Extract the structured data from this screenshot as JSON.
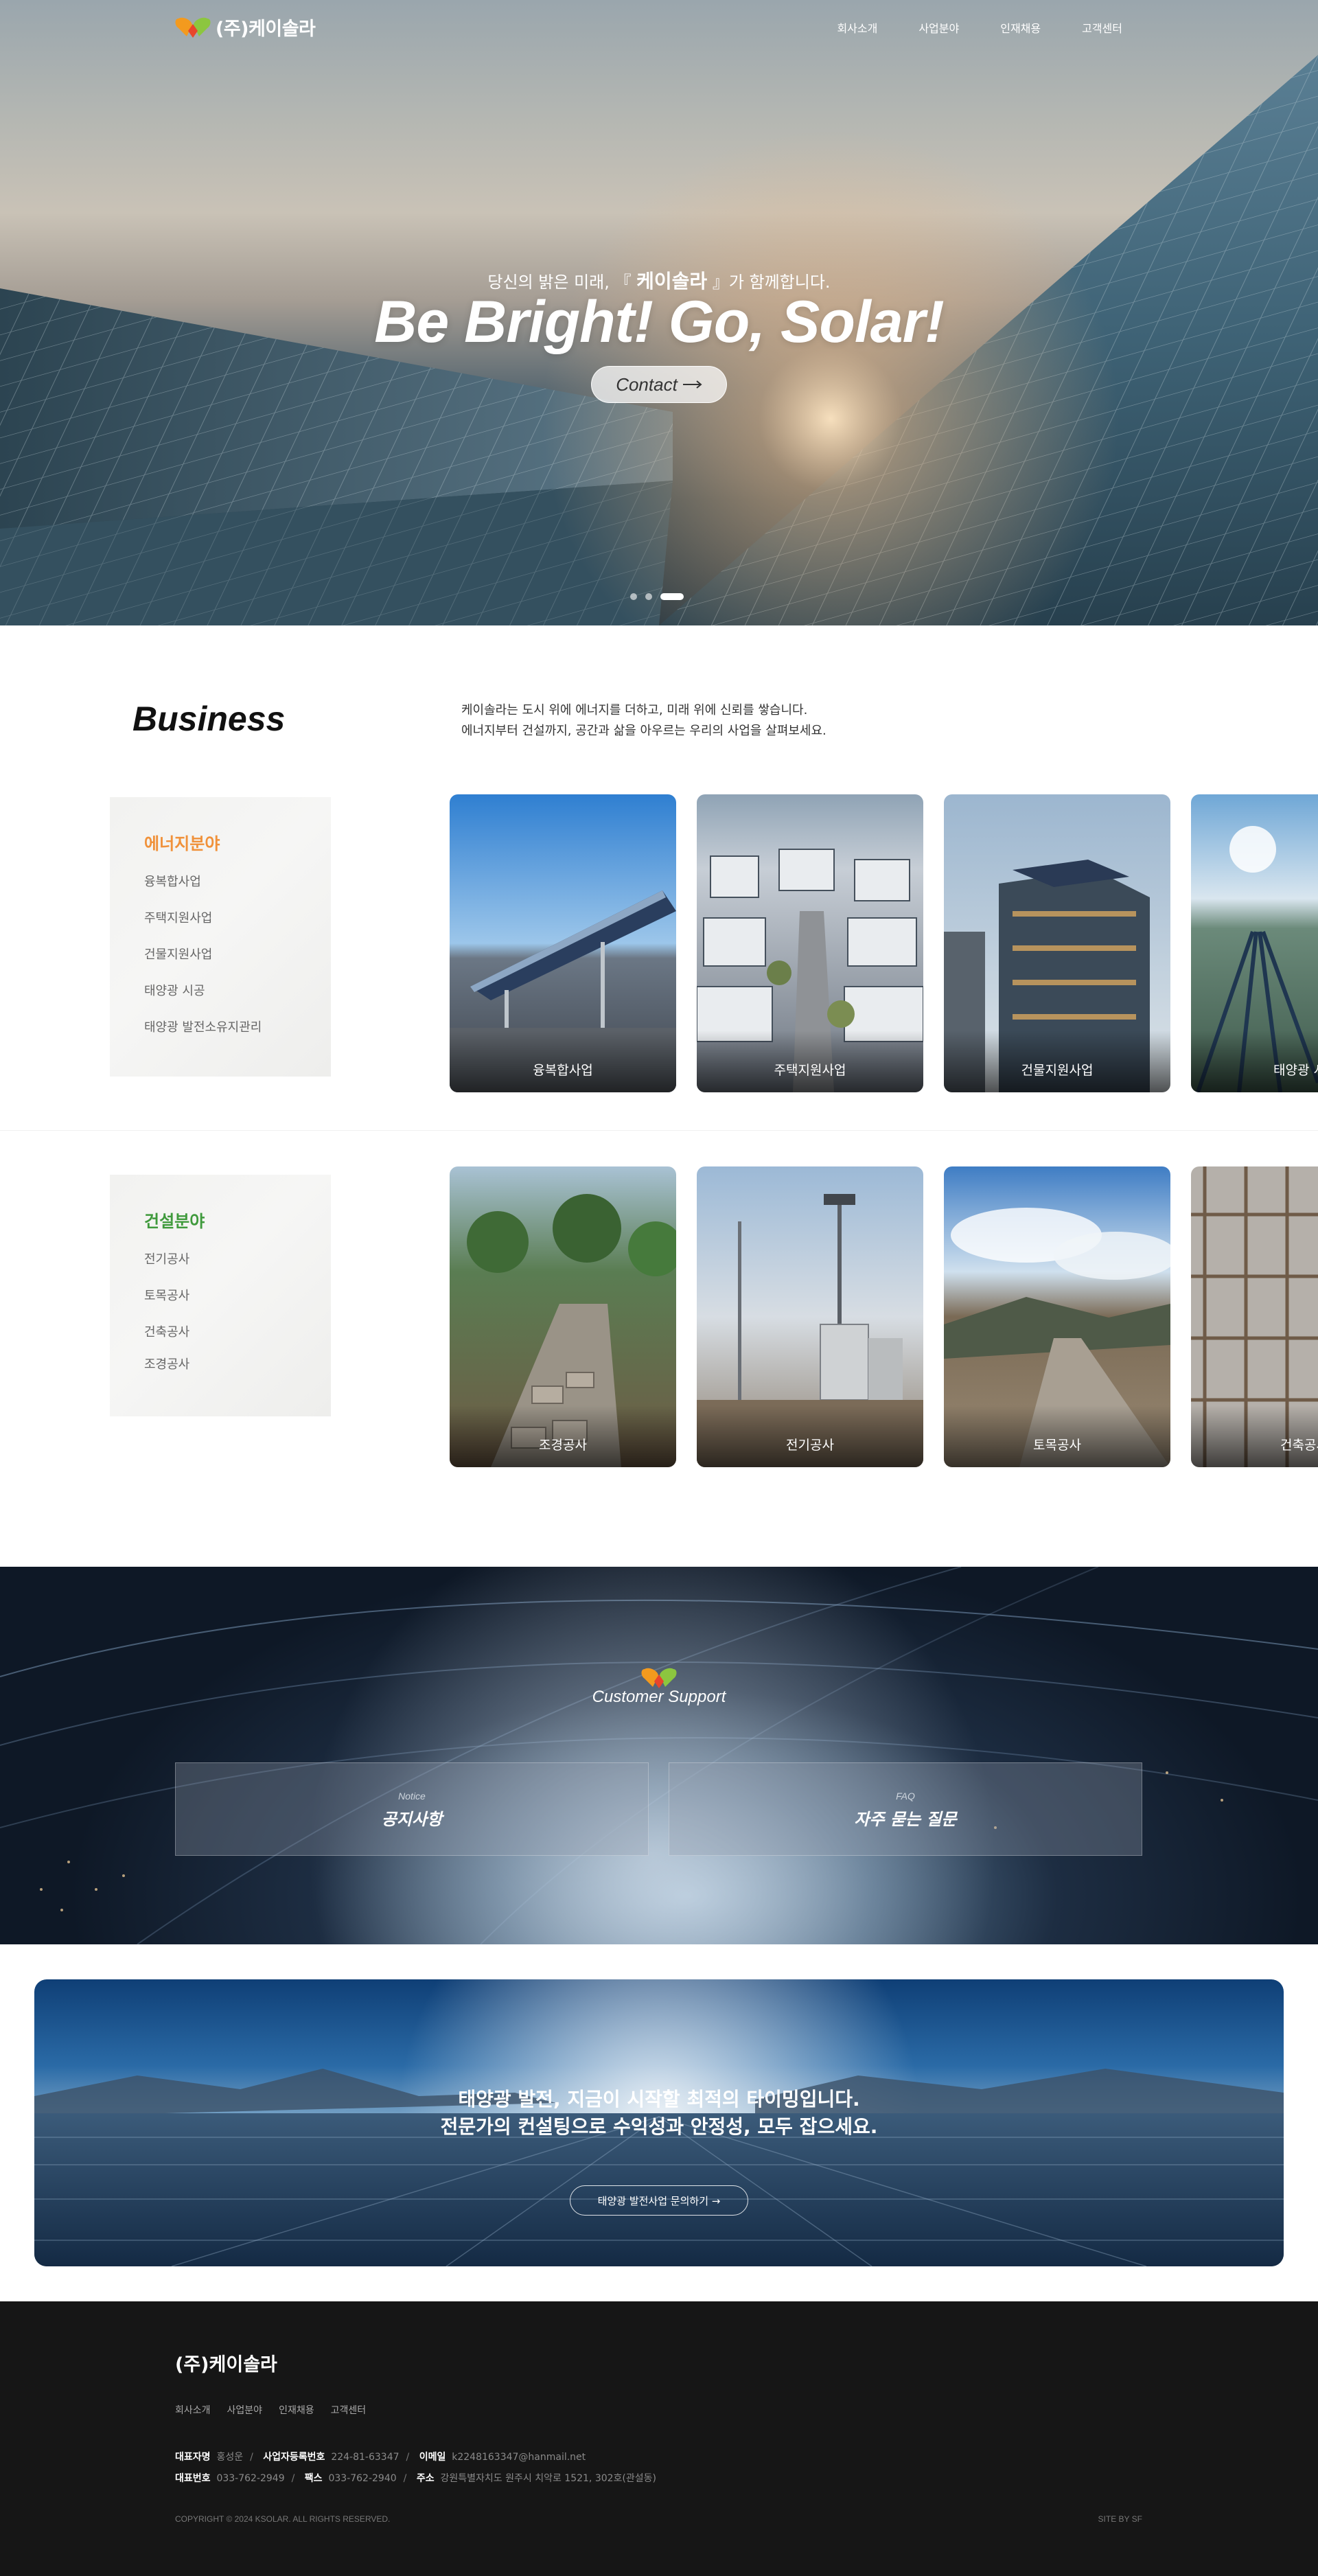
{
  "header": {
    "brand": "(주)케이솔라",
    "menu": [
      "회사소개",
      "사업분야",
      "인재채용",
      "고객센터"
    ]
  },
  "hero": {
    "subtitle_pre": "당신의 밝은 미래, 『 ",
    "subtitle_brand": "케이솔라",
    "subtitle_post": " 』가 함께합니다.",
    "title": "Be Bright! Go, Solar!",
    "button_label": "Contact",
    "slide_count": 3,
    "active_slide": 3
  },
  "business": {
    "title": "Business",
    "desc_line1": "케이솔라는 도시 위에 에너지를 더하고, 미래 위에 신뢰를 쌓습니다.",
    "desc_line2": "에너지부터 건설까지, 공간과 삶을 아우르는 우리의 사업을 살펴보세요.",
    "energy": {
      "title": "에너지분야",
      "title_color": "#f0913a",
      "items": [
        "융복합사업",
        "주택지원사업",
        "건물지원사업",
        "태양광 시공",
        "태양광 발전소유지관리"
      ],
      "cards": [
        "융복합사업",
        "주택지원사업",
        "건물지원사업",
        "태양광 시공"
      ]
    },
    "construction": {
      "title": "건설분야",
      "title_color": "#3f9a3c",
      "items": [
        "전기공사",
        "토목공사",
        "건축공사",
        "조경공사"
      ],
      "cards": [
        "조경공사",
        "전기공사",
        "토목공사",
        "건축공사"
      ]
    }
  },
  "support": {
    "title": "Customer Support",
    "notice_small": "Notice",
    "notice_big": "공지사항",
    "faq_small": "FAQ",
    "faq_big": "자주 묻는 질문"
  },
  "cta": {
    "line1": "태양광 발전, 지금이 시작할 최적의 타이밍입니다.",
    "line2": "전문가의 컨설팅으로 수익성과 안정성, 모두 잡으세요.",
    "button_label": "태양광 발전사업 문의하기 →"
  },
  "footer": {
    "brand": "(주)케이솔라",
    "menu": [
      "회사소개",
      "사업분야",
      "인재채용",
      "고객센터"
    ],
    "ceo_label": "대표자명",
    "ceo": "홍성운",
    "biz_label": "사업자등록번호",
    "biz": "224-81-63347",
    "email_label": "이메일",
    "email": "k2248163347@hanmail.net",
    "phone_label": "대표번호",
    "phone": "033-762-2949",
    "fax_label": "팩스",
    "fax": "033-762-2940",
    "addr_label": "주소",
    "addr": "강원특별자치도 원주시 치악로 1521, 302호(관설동)",
    "copyright": "COPYRIGHT © 2024 KSOLAR. ALL RIGHTS RESERVED.",
    "site_by": "SITE BY SF"
  },
  "colors": {
    "logo_orange": "#f39a1e",
    "logo_green": "#8cc63f",
    "logo_red": "#e8452c",
    "footer_bg": "#161616"
  },
  "icons": [
    "heart-logo-icon",
    "arrow-right-icon"
  ]
}
